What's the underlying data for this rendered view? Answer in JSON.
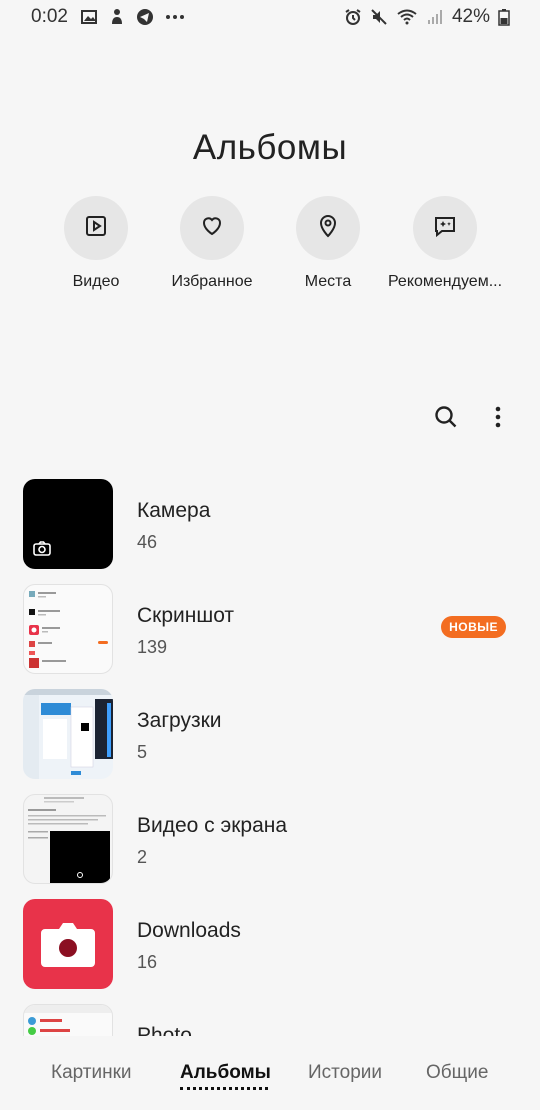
{
  "status_bar": {
    "time": "0:02",
    "battery": "42%",
    "left_icons": [
      "gallery-icon",
      "location-person-icon",
      "telegram-icon",
      "more-dots-icon"
    ],
    "right_icons": [
      "alarm-icon",
      "mute-icon",
      "wifi-icon",
      "signal-icon",
      "battery-icon"
    ],
    "more": "···"
  },
  "page_title": "Альбомы",
  "quick_access": [
    {
      "label": "Видео",
      "icon": "video-icon"
    },
    {
      "label": "Избранное",
      "icon": "heart-icon"
    },
    {
      "label": "Места",
      "icon": "location-pin-icon"
    },
    {
      "label": "Рекомендуем...",
      "icon": "sparkle-chat-icon"
    }
  ],
  "toolbar": {
    "search_icon": "search-icon",
    "menu_icon": "more-vertical-icon"
  },
  "albums": [
    {
      "name": "Камера",
      "count": "46"
    },
    {
      "name": "Скриншот",
      "count": "139",
      "badge": "НОВЫЕ"
    },
    {
      "name": "Загрузки",
      "count": "5"
    },
    {
      "name": "Видео с экрана",
      "count": "2"
    },
    {
      "name": "Downloads",
      "count": "16"
    },
    {
      "name": "Photo",
      "count": ""
    }
  ],
  "bottom_nav": [
    {
      "label": "Картинки"
    },
    {
      "label": "Альбомы",
      "active": true
    },
    {
      "label": "Истории"
    },
    {
      "label": "Общие"
    }
  ],
  "colors": {
    "accent_badge": "#f36d21",
    "background": "#f6f6f6",
    "downloads_red": "#e8334a"
  }
}
